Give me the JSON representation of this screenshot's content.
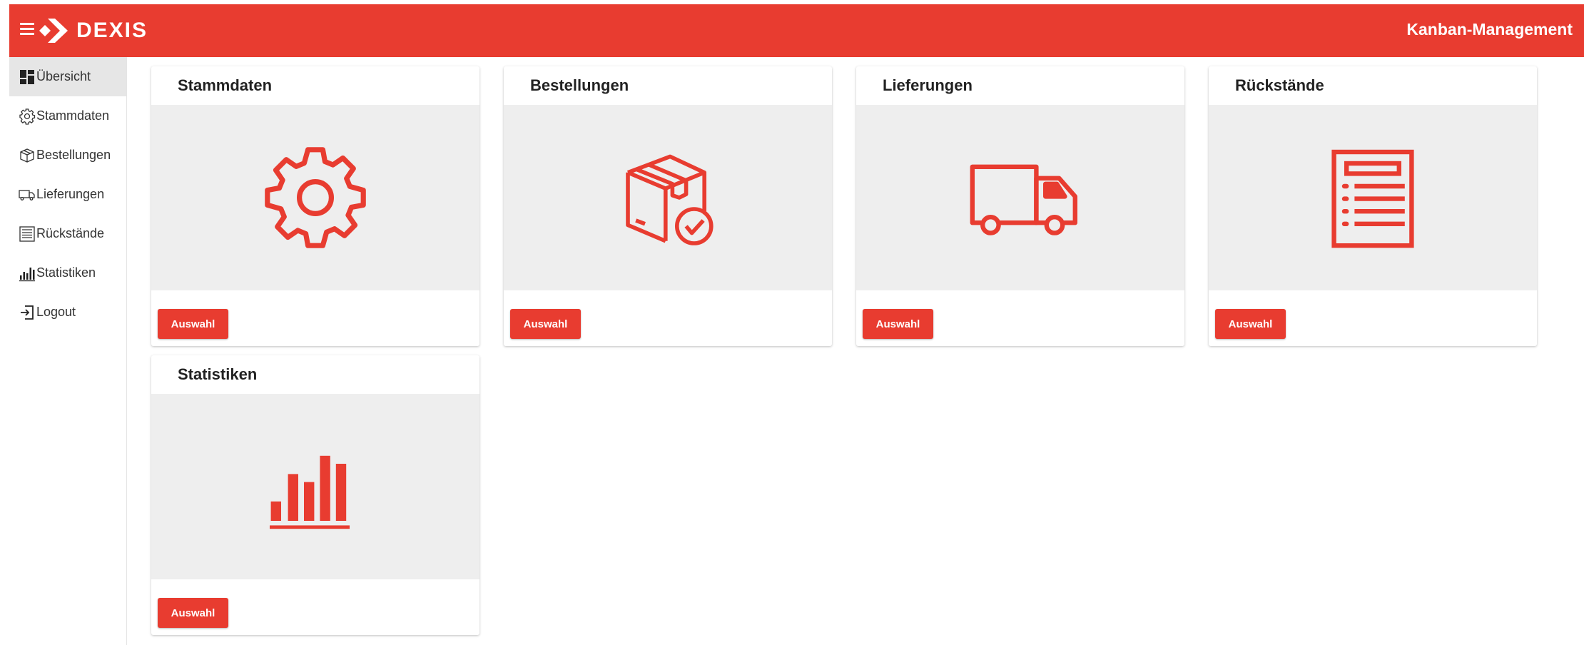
{
  "appbar": {
    "brand": "DEXIS",
    "title": "Kanban-Management",
    "color": "#e83c30"
  },
  "sidebar": {
    "items": [
      {
        "label": "Übersicht",
        "icon": "dashboard-icon",
        "active": true
      },
      {
        "label": "Stammdaten",
        "icon": "gear-icon"
      },
      {
        "label": "Bestellungen",
        "icon": "box-icon"
      },
      {
        "label": "Lieferungen",
        "icon": "truck-icon"
      },
      {
        "label": "Rückstände",
        "icon": "list-icon"
      },
      {
        "label": "Statistiken",
        "icon": "bar-chart-icon"
      },
      {
        "label": "Logout",
        "icon": "logout-icon"
      }
    ]
  },
  "cards": [
    {
      "title": "Stammdaten",
      "icon": "gear-icon",
      "button": "Auswahl"
    },
    {
      "title": "Bestellungen",
      "icon": "box-check-icon",
      "button": "Auswahl"
    },
    {
      "title": "Lieferungen",
      "icon": "truck-icon",
      "button": "Auswahl"
    },
    {
      "title": "Rückstände",
      "icon": "document-list-icon",
      "button": "Auswahl"
    },
    {
      "title": "Statistiken",
      "icon": "bar-chart-icon",
      "button": "Auswahl"
    }
  ]
}
